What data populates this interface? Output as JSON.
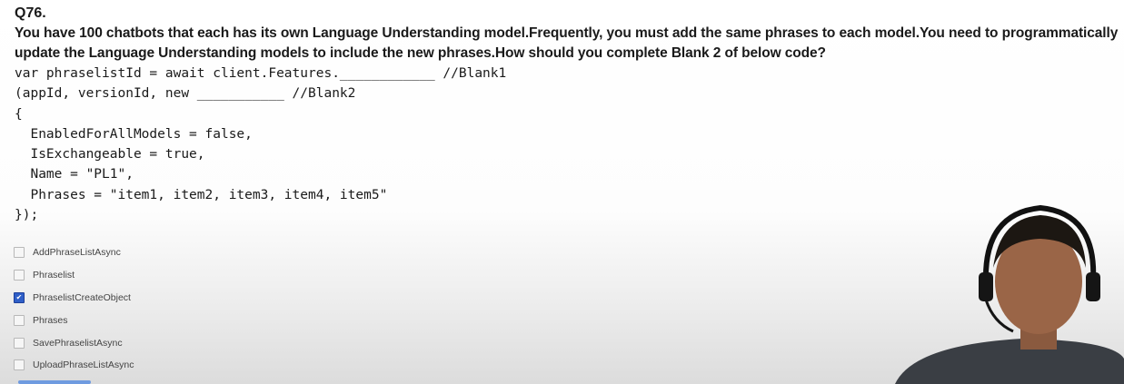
{
  "question": {
    "number": "Q76.",
    "text": "You have 100 chatbots that each has its own Language Understanding model.Frequently, you must add the same phrases to each model.You need to programmatically update the Language Understanding models to include the new phrases.How should you complete Blank 2 of below code?",
    "code": [
      "var phraselistId = await client.Features.____________ //Blank1",
      "(appId, versionId, new ___________ //Blank2",
      "{",
      "  EnabledForAllModels = false,",
      "  IsExchangeable = true,",
      "  Name = \"PL1\",",
      "  Phrases = \"item1, item2, item3, item4, item5\"",
      "});"
    ]
  },
  "options": [
    {
      "label": "AddPhraseListAsync",
      "checked": false
    },
    {
      "label": "Phraselist",
      "checked": false
    },
    {
      "label": "PhraselistCreateObject",
      "checked": true
    },
    {
      "label": "Phrases",
      "checked": false
    },
    {
      "label": "SavePhraselistAsync",
      "checked": false
    },
    {
      "label": "UploadPhraseListAsync",
      "checked": false
    }
  ],
  "colors": {
    "checkbox_checked": "#2f5fc8"
  }
}
